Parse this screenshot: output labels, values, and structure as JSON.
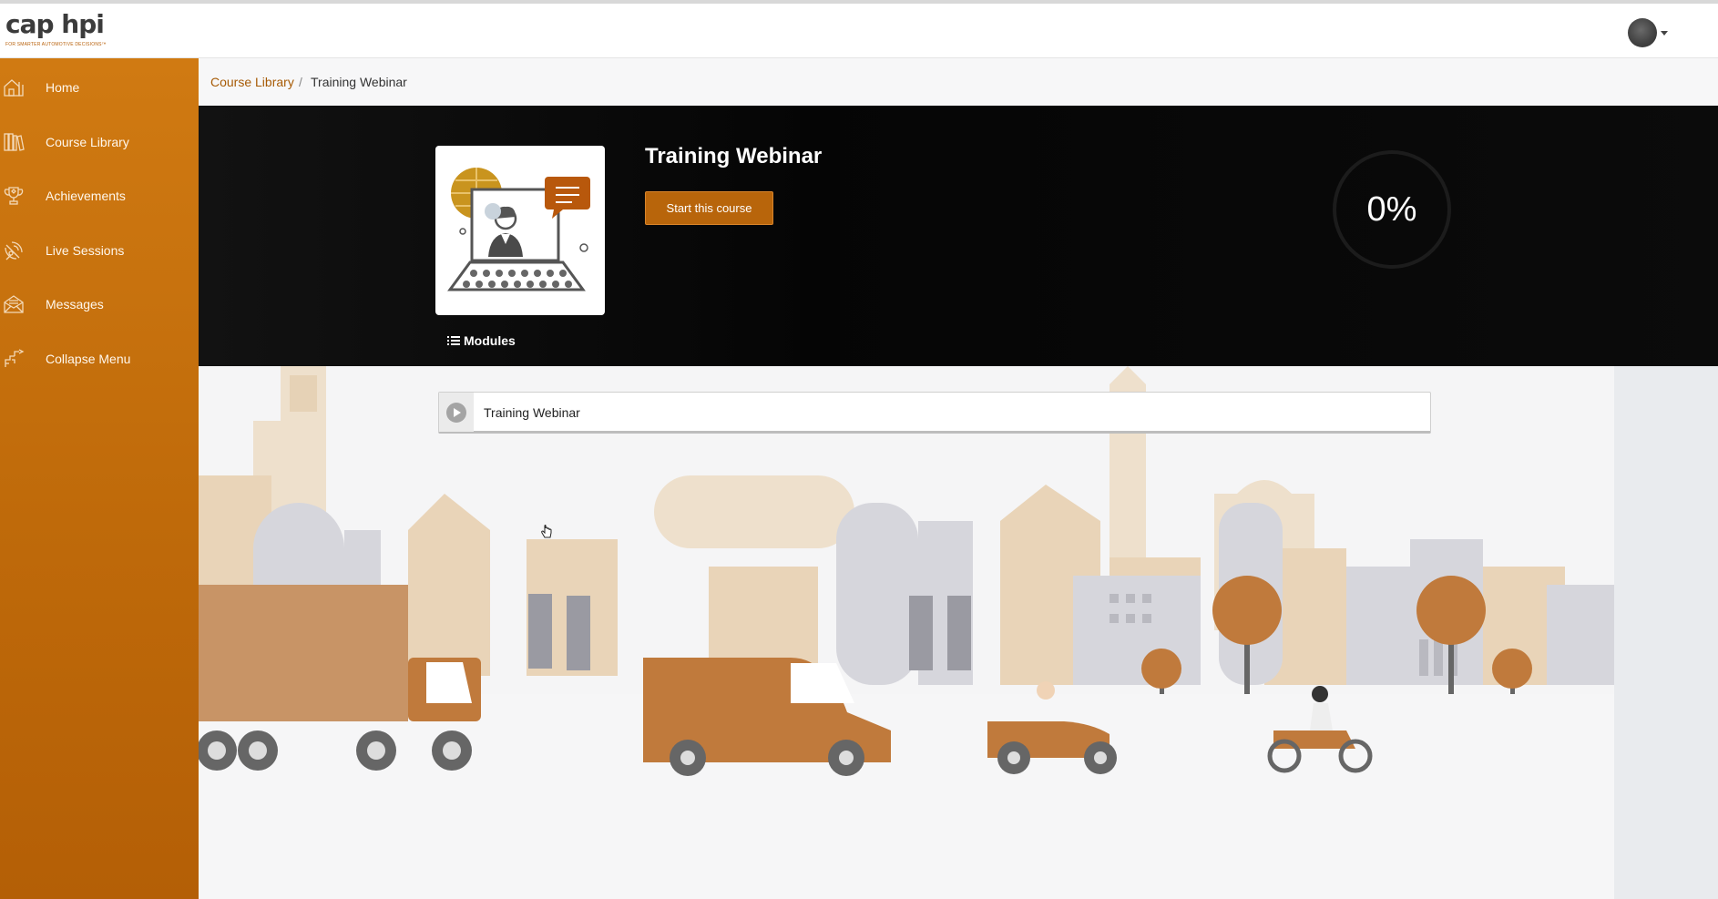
{
  "brand": {
    "logo_text": "cap hpi",
    "tagline": "FOR SMARTER AUTOMOTIVE DECISIONS™"
  },
  "header": {
    "avatar_icon": "user-avatar"
  },
  "sidebar": {
    "items": [
      {
        "label": "Home",
        "icon": "home-icon"
      },
      {
        "label": "Course Library",
        "icon": "books-icon"
      },
      {
        "label": "Achievements",
        "icon": "trophy-icon"
      },
      {
        "label": "Live Sessions",
        "icon": "satellite-icon"
      },
      {
        "label": "Messages",
        "icon": "envelope-icon"
      },
      {
        "label": "Collapse Menu",
        "icon": "collapse-icon"
      }
    ]
  },
  "breadcrumb": {
    "parent": "Course Library",
    "separator": "/",
    "current": "Training Webinar"
  },
  "course": {
    "title": "Training Webinar",
    "start_label": "Start this course",
    "progress_text": "0%",
    "progress_fraction": 0,
    "modules_tab_label": "Modules"
  },
  "modules": [
    {
      "label": "Training Webinar",
      "icon": "play-icon"
    }
  ],
  "colors": {
    "brand_orange": "#c4700d",
    "button_orange": "#b8650b",
    "hero_background": "#080808",
    "link_color": "#a75b06"
  }
}
